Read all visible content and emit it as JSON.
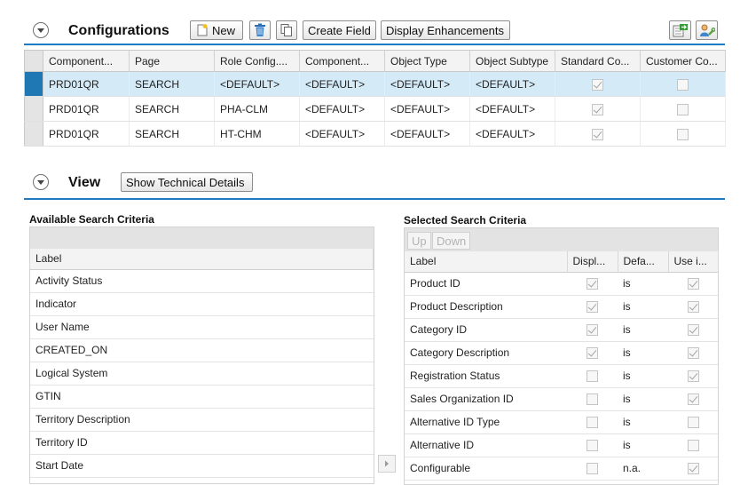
{
  "configurations": {
    "title": "Configurations",
    "toolbar": {
      "new_label": "New",
      "create_field_label": "Create Field",
      "display_enhancements_label": "Display Enhancements"
    },
    "columns": [
      "Component...",
      "Page",
      "Role Config....",
      "Component...",
      "Object Type",
      "Object Subtype",
      "Standard Co...",
      "Customer Co..."
    ],
    "rows": [
      {
        "component": "PRD01QR",
        "page": "SEARCH",
        "role_config": "<DEFAULT>",
        "component2": "<DEFAULT>",
        "object_type": "<DEFAULT>",
        "object_subtype": "<DEFAULT>",
        "standard": true,
        "customer": false,
        "selected": true
      },
      {
        "component": "PRD01QR",
        "page": "SEARCH",
        "role_config": "PHA-CLM",
        "component2": "<DEFAULT>",
        "object_type": "<DEFAULT>",
        "object_subtype": "<DEFAULT>",
        "standard": true,
        "customer": false,
        "selected": false
      },
      {
        "component": "PRD01QR",
        "page": "SEARCH",
        "role_config": "HT-CHM",
        "component2": "<DEFAULT>",
        "object_type": "<DEFAULT>",
        "object_subtype": "<DEFAULT>",
        "standard": true,
        "customer": false,
        "selected": false
      }
    ]
  },
  "view": {
    "title": "View",
    "show_technical_details_label": "Show Technical Details"
  },
  "available": {
    "title": "Available Search Criteria",
    "column_label": "Label",
    "items": [
      "Activity Status",
      "Indicator",
      "User Name",
      "CREATED_ON",
      "Logical System",
      "GTIN",
      "Territory Description",
      "Territory ID",
      "Start Date"
    ]
  },
  "selected": {
    "title": "Selected Search Criteria",
    "up_label": "Up",
    "down_label": "Down",
    "columns": [
      "Label",
      "Displ...",
      "Defa...",
      "Use i..."
    ],
    "rows": [
      {
        "label": "Product ID",
        "display": true,
        "default": "is",
        "use": true
      },
      {
        "label": "Product Description",
        "display": true,
        "default": "is",
        "use": true
      },
      {
        "label": "Category ID",
        "display": true,
        "default": "is",
        "use": true
      },
      {
        "label": "Category Description",
        "display": true,
        "default": "is",
        "use": true
      },
      {
        "label": "Registration Status",
        "display": false,
        "default": "is",
        "use": true
      },
      {
        "label": "Sales Organization ID",
        "display": false,
        "default": "is",
        "use": true
      },
      {
        "label": "Alternative ID Type",
        "display": false,
        "default": "is",
        "use": false
      },
      {
        "label": "Alternative ID",
        "display": false,
        "default": "is",
        "use": false
      },
      {
        "label": "Configurable",
        "display": false,
        "default": "n.a.",
        "use": true
      }
    ]
  },
  "colors": {
    "accent_blue": "#1c7bc2",
    "selected_row": "#d4eaf6",
    "selector_blue": "#1f78b4"
  }
}
